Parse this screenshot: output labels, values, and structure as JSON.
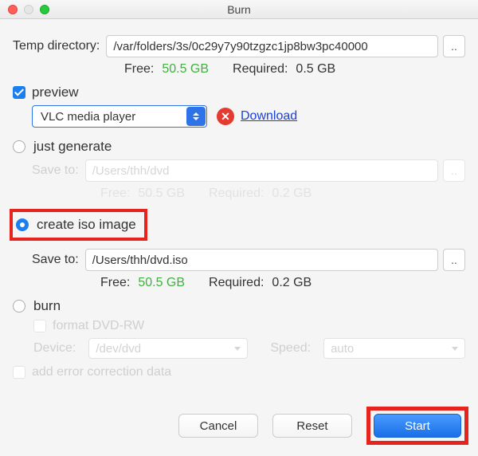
{
  "window": {
    "title": "Burn"
  },
  "temp": {
    "label": "Temp directory:",
    "path": "/var/folders/3s/0c29y7y90tzgzc1jp8bw3pc40000",
    "browse": "..",
    "free_label": "Free:",
    "free_value": "50.5 GB",
    "required_label": "Required:",
    "required_value": "0.5 GB"
  },
  "preview": {
    "label": "preview",
    "player": "VLC media player",
    "download": "Download"
  },
  "justgen": {
    "label": "just generate",
    "save_label": "Save to:",
    "save_path": "/Users/thh/dvd",
    "browse": "..",
    "free_label": "Free:",
    "free_value": "50.5 GB",
    "required_label": "Required:",
    "required_value": "0.2 GB"
  },
  "iso": {
    "label": "create iso image",
    "save_label": "Save to:",
    "save_path": "/Users/thh/dvd.iso",
    "browse": "..",
    "free_label": "Free:",
    "free_value": "50.5 GB",
    "required_label": "Required:",
    "required_value": "0.2 GB"
  },
  "burn": {
    "label": "burn",
    "format_label": "format DVD-RW",
    "device_label": "Device:",
    "device_value": "/dev/dvd",
    "speed_label": "Speed:",
    "speed_value": "auto"
  },
  "error_correction": {
    "label": "add error correction data"
  },
  "buttons": {
    "cancel": "Cancel",
    "reset": "Reset",
    "start": "Start"
  }
}
